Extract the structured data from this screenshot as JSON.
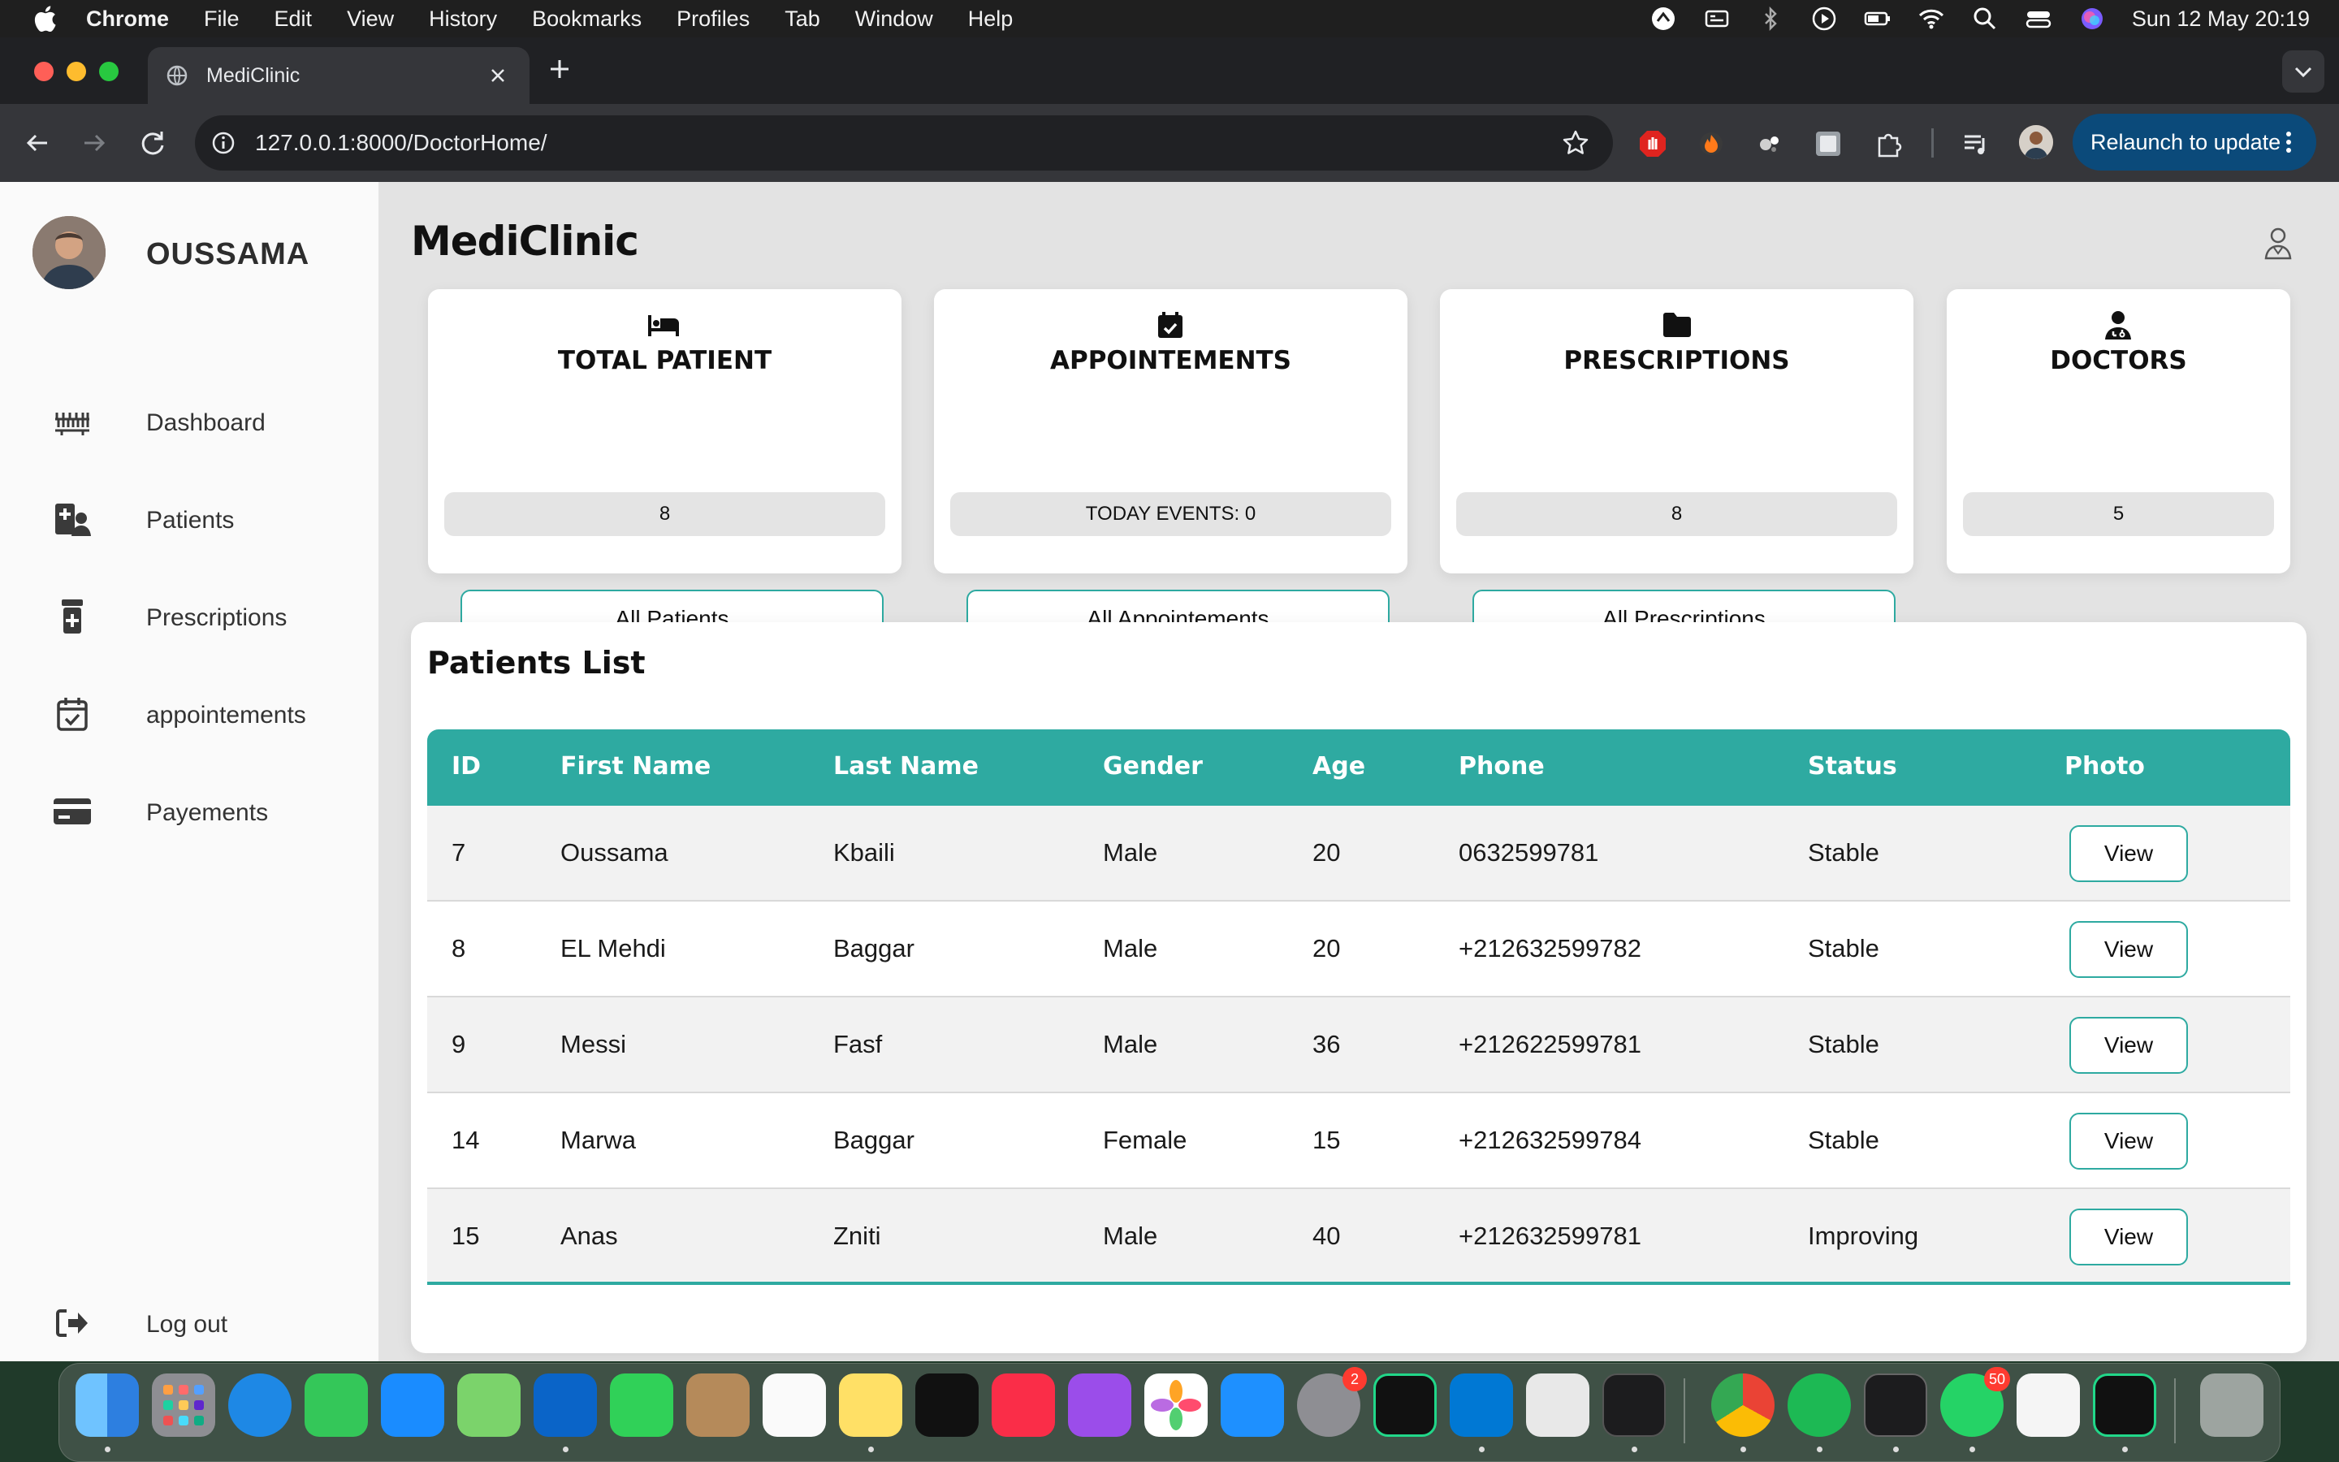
{
  "menubar": {
    "app_name": "Chrome",
    "items": [
      "File",
      "Edit",
      "View",
      "History",
      "Bookmarks",
      "Profiles",
      "Tab",
      "Window",
      "Help"
    ],
    "clock": "Sun 12 May  20:19"
  },
  "browser": {
    "tab_title": "MediClinic",
    "url": "127.0.0.1:8000/DoctorHome/",
    "relaunch_label": "Relaunch to update"
  },
  "sidebar": {
    "user_name": "OUSSAMA",
    "items": [
      {
        "label": "Dashboard",
        "icon": "dashboard-icon"
      },
      {
        "label": "Patients",
        "icon": "patients-icon"
      },
      {
        "label": "Prescriptions",
        "icon": "prescription-bottle-icon"
      },
      {
        "label": "appointements",
        "icon": "calendar-check-icon"
      },
      {
        "label": "Payements",
        "icon": "credit-card-icon"
      }
    ],
    "logout_label": "Log out"
  },
  "main": {
    "title": "MediClinic",
    "cards": [
      {
        "title": "TOTAL PATIENT",
        "value": "8",
        "button": "All Patients",
        "icon": "bed-icon"
      },
      {
        "title": "APPOINTEMENTS",
        "value": "TODAY EVENTS: 0",
        "button": "All Appointements",
        "icon": "calendar-check-icon"
      },
      {
        "title": "PRESCRIPTIONS",
        "value": "8",
        "button": "All Prescriptions",
        "icon": "folder-icon"
      },
      {
        "title": "DOCTORS",
        "value": "5",
        "icon": "doctor-icon"
      }
    ],
    "patients": {
      "title": "Patients List",
      "columns": [
        "ID",
        "First Name",
        "Last Name",
        "Gender",
        "Age",
        "Phone",
        "Status",
        "Photo"
      ],
      "rows": [
        {
          "id": "7",
          "first": "Oussama",
          "last": "Kbaili",
          "gender": "Male",
          "age": "20",
          "phone": "0632599781",
          "status": "Stable",
          "action": "View"
        },
        {
          "id": "8",
          "first": "EL Mehdi",
          "last": "Baggar",
          "gender": "Male",
          "age": "20",
          "phone": "+212632599782",
          "status": "Stable",
          "action": "View"
        },
        {
          "id": "9",
          "first": "Messi",
          "last": "Fasf",
          "gender": "Male",
          "age": "36",
          "phone": "+212622599781",
          "status": "Stable",
          "action": "View"
        },
        {
          "id": "14",
          "first": "Marwa",
          "last": "Baggar",
          "gender": "Female",
          "age": "15",
          "phone": "+212632599784",
          "status": "Stable",
          "action": "View"
        },
        {
          "id": "15",
          "first": "Anas",
          "last": "Zniti",
          "gender": "Male",
          "age": "40",
          "phone": "+212632599781",
          "status": "Improving",
          "action": "View"
        }
      ]
    }
  },
  "dock": {
    "apps": [
      "finder",
      "launchpad",
      "safari",
      "messages",
      "mail",
      "maps",
      "outlook",
      "facetime",
      "contacts",
      "reminders",
      "notes",
      "apple-tv",
      "music",
      "podcasts",
      "photos",
      "app-store",
      "system-settings",
      "pycharm",
      "vscode",
      "roblox",
      "terminal",
      "chrome",
      "spotify",
      "activity-monitor",
      "whatsapp",
      "textedit",
      "pycharm-ce",
      "trash"
    ],
    "badges": {
      "system_settings": "2",
      "whatsapp": "50"
    }
  },
  "colors": {
    "accent": "#2eaaa1",
    "page_bg": "#e3e3e3",
    "sidebar_bg": "#fafafa"
  }
}
